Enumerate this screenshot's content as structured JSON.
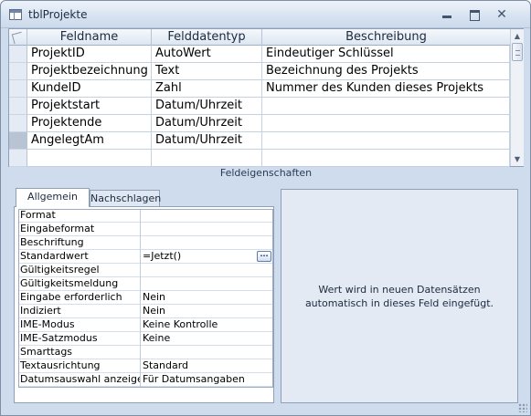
{
  "window": {
    "title": "tblProjekte"
  },
  "grid": {
    "columns": [
      "Feldname",
      "Felddatentyp",
      "Beschreibung"
    ],
    "rows": [
      {
        "name": "ProjektID",
        "type": "AutoWert",
        "description": "Eindeutiger Schlüssel"
      },
      {
        "name": "Projektbezeichnung",
        "type": "Text",
        "description": "Bezeichnung des Projekts"
      },
      {
        "name": "KundeID",
        "type": "Zahl",
        "description": "Nummer des Kunden dieses Projekts"
      },
      {
        "name": "Projektstart",
        "type": "Datum/Uhrzeit",
        "description": ""
      },
      {
        "name": "Projektende",
        "type": "Datum/Uhrzeit",
        "description": ""
      },
      {
        "name": "AngelegtAm",
        "type": "Datum/Uhrzeit",
        "description": ""
      },
      {
        "name": "",
        "type": "",
        "description": ""
      }
    ],
    "active_row": 5
  },
  "section_label": "Feldeigenschaften",
  "tabs": [
    "Allgemein",
    "Nachschlagen"
  ],
  "properties": [
    {
      "name": "Format",
      "value": ""
    },
    {
      "name": "Eingabeformat",
      "value": ""
    },
    {
      "name": "Beschriftung",
      "value": ""
    },
    {
      "name": "Standardwert",
      "value": "=Jetzt()",
      "has_builder": true
    },
    {
      "name": "Gültigkeitsregel",
      "value": ""
    },
    {
      "name": "Gültigkeitsmeldung",
      "value": ""
    },
    {
      "name": "Eingabe erforderlich",
      "value": "Nein"
    },
    {
      "name": "Indiziert",
      "value": "Nein"
    },
    {
      "name": "IME-Modus",
      "value": "Keine Kontrolle"
    },
    {
      "name": "IME-Satzmodus",
      "value": "Keine"
    },
    {
      "name": "Smarttags",
      "value": ""
    },
    {
      "name": "Textausrichtung",
      "value": "Standard"
    },
    {
      "name": "Datumsauswahl anzeigen",
      "value": "Für Datumsangaben"
    }
  ],
  "builder_label": "...",
  "help_text": "Wert wird in neuen Datensätzen automatisch in dieses Feld eingefügt.",
  "icons": {
    "table_icon": "table-icon",
    "minimize": "minimize-icon",
    "maximize": "maximize-icon",
    "close": "close-icon",
    "close_glyph": "✕",
    "scroll_up_glyph": "▲",
    "scroll_down_glyph": "▼"
  }
}
